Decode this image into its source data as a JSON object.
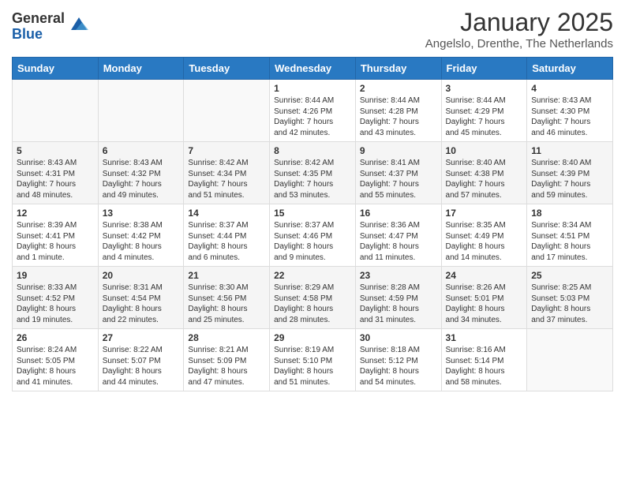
{
  "logo": {
    "general": "General",
    "blue": "Blue"
  },
  "title": "January 2025",
  "location": "Angelslo, Drenthe, The Netherlands",
  "weekdays": [
    "Sunday",
    "Monday",
    "Tuesday",
    "Wednesday",
    "Thursday",
    "Friday",
    "Saturday"
  ],
  "weeks": [
    [
      {
        "day": "",
        "info": ""
      },
      {
        "day": "",
        "info": ""
      },
      {
        "day": "",
        "info": ""
      },
      {
        "day": "1",
        "info": "Sunrise: 8:44 AM\nSunset: 4:26 PM\nDaylight: 7 hours\nand 42 minutes."
      },
      {
        "day": "2",
        "info": "Sunrise: 8:44 AM\nSunset: 4:28 PM\nDaylight: 7 hours\nand 43 minutes."
      },
      {
        "day": "3",
        "info": "Sunrise: 8:44 AM\nSunset: 4:29 PM\nDaylight: 7 hours\nand 45 minutes."
      },
      {
        "day": "4",
        "info": "Sunrise: 8:43 AM\nSunset: 4:30 PM\nDaylight: 7 hours\nand 46 minutes."
      }
    ],
    [
      {
        "day": "5",
        "info": "Sunrise: 8:43 AM\nSunset: 4:31 PM\nDaylight: 7 hours\nand 48 minutes."
      },
      {
        "day": "6",
        "info": "Sunrise: 8:43 AM\nSunset: 4:32 PM\nDaylight: 7 hours\nand 49 minutes."
      },
      {
        "day": "7",
        "info": "Sunrise: 8:42 AM\nSunset: 4:34 PM\nDaylight: 7 hours\nand 51 minutes."
      },
      {
        "day": "8",
        "info": "Sunrise: 8:42 AM\nSunset: 4:35 PM\nDaylight: 7 hours\nand 53 minutes."
      },
      {
        "day": "9",
        "info": "Sunrise: 8:41 AM\nSunset: 4:37 PM\nDaylight: 7 hours\nand 55 minutes."
      },
      {
        "day": "10",
        "info": "Sunrise: 8:40 AM\nSunset: 4:38 PM\nDaylight: 7 hours\nand 57 minutes."
      },
      {
        "day": "11",
        "info": "Sunrise: 8:40 AM\nSunset: 4:39 PM\nDaylight: 7 hours\nand 59 minutes."
      }
    ],
    [
      {
        "day": "12",
        "info": "Sunrise: 8:39 AM\nSunset: 4:41 PM\nDaylight: 8 hours\nand 1 minute."
      },
      {
        "day": "13",
        "info": "Sunrise: 8:38 AM\nSunset: 4:42 PM\nDaylight: 8 hours\nand 4 minutes."
      },
      {
        "day": "14",
        "info": "Sunrise: 8:37 AM\nSunset: 4:44 PM\nDaylight: 8 hours\nand 6 minutes."
      },
      {
        "day": "15",
        "info": "Sunrise: 8:37 AM\nSunset: 4:46 PM\nDaylight: 8 hours\nand 9 minutes."
      },
      {
        "day": "16",
        "info": "Sunrise: 8:36 AM\nSunset: 4:47 PM\nDaylight: 8 hours\nand 11 minutes."
      },
      {
        "day": "17",
        "info": "Sunrise: 8:35 AM\nSunset: 4:49 PM\nDaylight: 8 hours\nand 14 minutes."
      },
      {
        "day": "18",
        "info": "Sunrise: 8:34 AM\nSunset: 4:51 PM\nDaylight: 8 hours\nand 17 minutes."
      }
    ],
    [
      {
        "day": "19",
        "info": "Sunrise: 8:33 AM\nSunset: 4:52 PM\nDaylight: 8 hours\nand 19 minutes."
      },
      {
        "day": "20",
        "info": "Sunrise: 8:31 AM\nSunset: 4:54 PM\nDaylight: 8 hours\nand 22 minutes."
      },
      {
        "day": "21",
        "info": "Sunrise: 8:30 AM\nSunset: 4:56 PM\nDaylight: 8 hours\nand 25 minutes."
      },
      {
        "day": "22",
        "info": "Sunrise: 8:29 AM\nSunset: 4:58 PM\nDaylight: 8 hours\nand 28 minutes."
      },
      {
        "day": "23",
        "info": "Sunrise: 8:28 AM\nSunset: 4:59 PM\nDaylight: 8 hours\nand 31 minutes."
      },
      {
        "day": "24",
        "info": "Sunrise: 8:26 AM\nSunset: 5:01 PM\nDaylight: 8 hours\nand 34 minutes."
      },
      {
        "day": "25",
        "info": "Sunrise: 8:25 AM\nSunset: 5:03 PM\nDaylight: 8 hours\nand 37 minutes."
      }
    ],
    [
      {
        "day": "26",
        "info": "Sunrise: 8:24 AM\nSunset: 5:05 PM\nDaylight: 8 hours\nand 41 minutes."
      },
      {
        "day": "27",
        "info": "Sunrise: 8:22 AM\nSunset: 5:07 PM\nDaylight: 8 hours\nand 44 minutes."
      },
      {
        "day": "28",
        "info": "Sunrise: 8:21 AM\nSunset: 5:09 PM\nDaylight: 8 hours\nand 47 minutes."
      },
      {
        "day": "29",
        "info": "Sunrise: 8:19 AM\nSunset: 5:10 PM\nDaylight: 8 hours\nand 51 minutes."
      },
      {
        "day": "30",
        "info": "Sunrise: 8:18 AM\nSunset: 5:12 PM\nDaylight: 8 hours\nand 54 minutes."
      },
      {
        "day": "31",
        "info": "Sunrise: 8:16 AM\nSunset: 5:14 PM\nDaylight: 8 hours\nand 58 minutes."
      },
      {
        "day": "",
        "info": ""
      }
    ]
  ]
}
